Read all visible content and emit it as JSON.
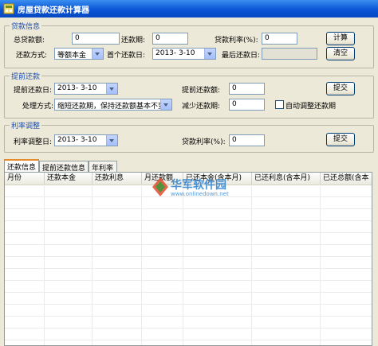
{
  "window": {
    "title": "房屋贷款还款计算器"
  },
  "loan_info": {
    "legend": "贷款信息",
    "total_label": "总贷款额:",
    "total_value": "0",
    "periods_label": "还款期:",
    "periods_value": "0",
    "rate_label": "贷款利率(%):",
    "rate_value": "0",
    "method_label": "还款方式:",
    "method_value": "等额本金",
    "first_date_label": "首个还款日:",
    "first_date_value": "2013- 3-10",
    "last_date_label": "最后还款日:",
    "last_date_value": "",
    "calc_button": "计算",
    "clear_button": "清空"
  },
  "prepay": {
    "legend": "提前还款",
    "date_label": "提前还款日:",
    "date_value": "2013- 3-10",
    "amount_label": "提前还款额:",
    "amount_value": "0",
    "submit_button": "提交",
    "mode_label": "处理方式:",
    "mode_value": "缩短还款期，保持还款额基本不变",
    "reduce_label": "减少还款期:",
    "reduce_value": "0",
    "auto_label": "自动调整还款期"
  },
  "rate_adjust": {
    "legend": "利率调整",
    "date_label": "利率调整日:",
    "date_value": "2013- 3-10",
    "rate_label": "贷款利率(%):",
    "rate_value": "0",
    "submit_button": "提交"
  },
  "tabs": [
    "还款信息",
    "提前还款信息",
    "年利率"
  ],
  "table": {
    "columns": [
      "月份",
      "还款本金",
      "还款利息",
      "月还款额",
      "已还本金(含本月)",
      "已还利息(含本月)",
      "已还总额(含本"
    ]
  },
  "watermark": {
    "text": "华军软件园",
    "url": "www.onlinedown.net"
  },
  "colors": {
    "title_bar": "#0a55d6",
    "legend": "#1c4fb5",
    "tab_accent": "#e68b2c"
  }
}
